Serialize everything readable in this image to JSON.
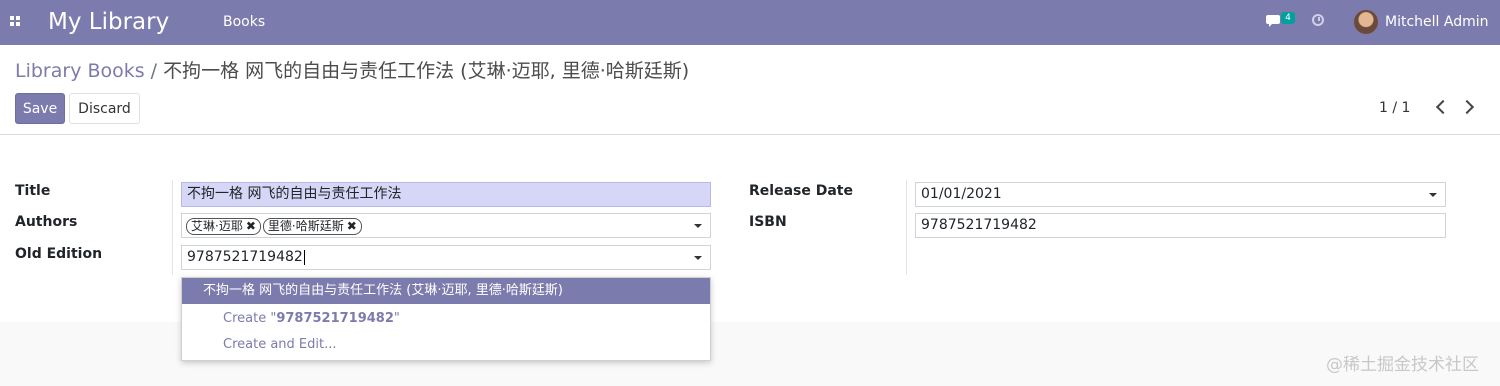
{
  "navbar": {
    "app_title": "My Library",
    "menu_books": "Books",
    "chat_badge": "4",
    "user_name": "Mitchell Admin"
  },
  "breadcrumb": {
    "parent": "Library Books",
    "separator": "/",
    "current": "不拘一格 网飞的自由与责任工作法 (艾琳·迈耶, 里德·哈斯廷斯)"
  },
  "buttons": {
    "save": "Save",
    "discard": "Discard"
  },
  "pager": {
    "value": "1 / 1"
  },
  "form": {
    "title_label": "Title",
    "title_value": "不拘一格 网飞的自由与责任工作法",
    "authors_label": "Authors",
    "authors": [
      "艾琳·迈耶",
      "里德·哈斯廷斯"
    ],
    "old_edition_label": "Old Edition",
    "old_edition_value": "9787521719482",
    "release_date_label": "Release Date",
    "release_date_value": "01/01/2021",
    "isbn_label": "ISBN",
    "isbn_value": "9787521719482"
  },
  "dropdown": {
    "option_match": "不拘一格 网飞的自由与责任工作法 (艾琳·迈耶, 里德·哈斯廷斯)",
    "create_prefix": "Create \"",
    "create_value": "9787521719482",
    "create_suffix": "\"",
    "create_and_edit": "Create and Edit..."
  },
  "watermark": "@稀土掘金技术社区",
  "colors": {
    "brand": "#7c7bad",
    "badge": "#00a09d",
    "highlight": "#d6d6f6"
  },
  "icons": {
    "apps": "grid-icon",
    "chat": "chat-bubbles-icon",
    "clock": "clock-icon",
    "prev": "chevron-left-icon",
    "next": "chevron-right-icon"
  }
}
